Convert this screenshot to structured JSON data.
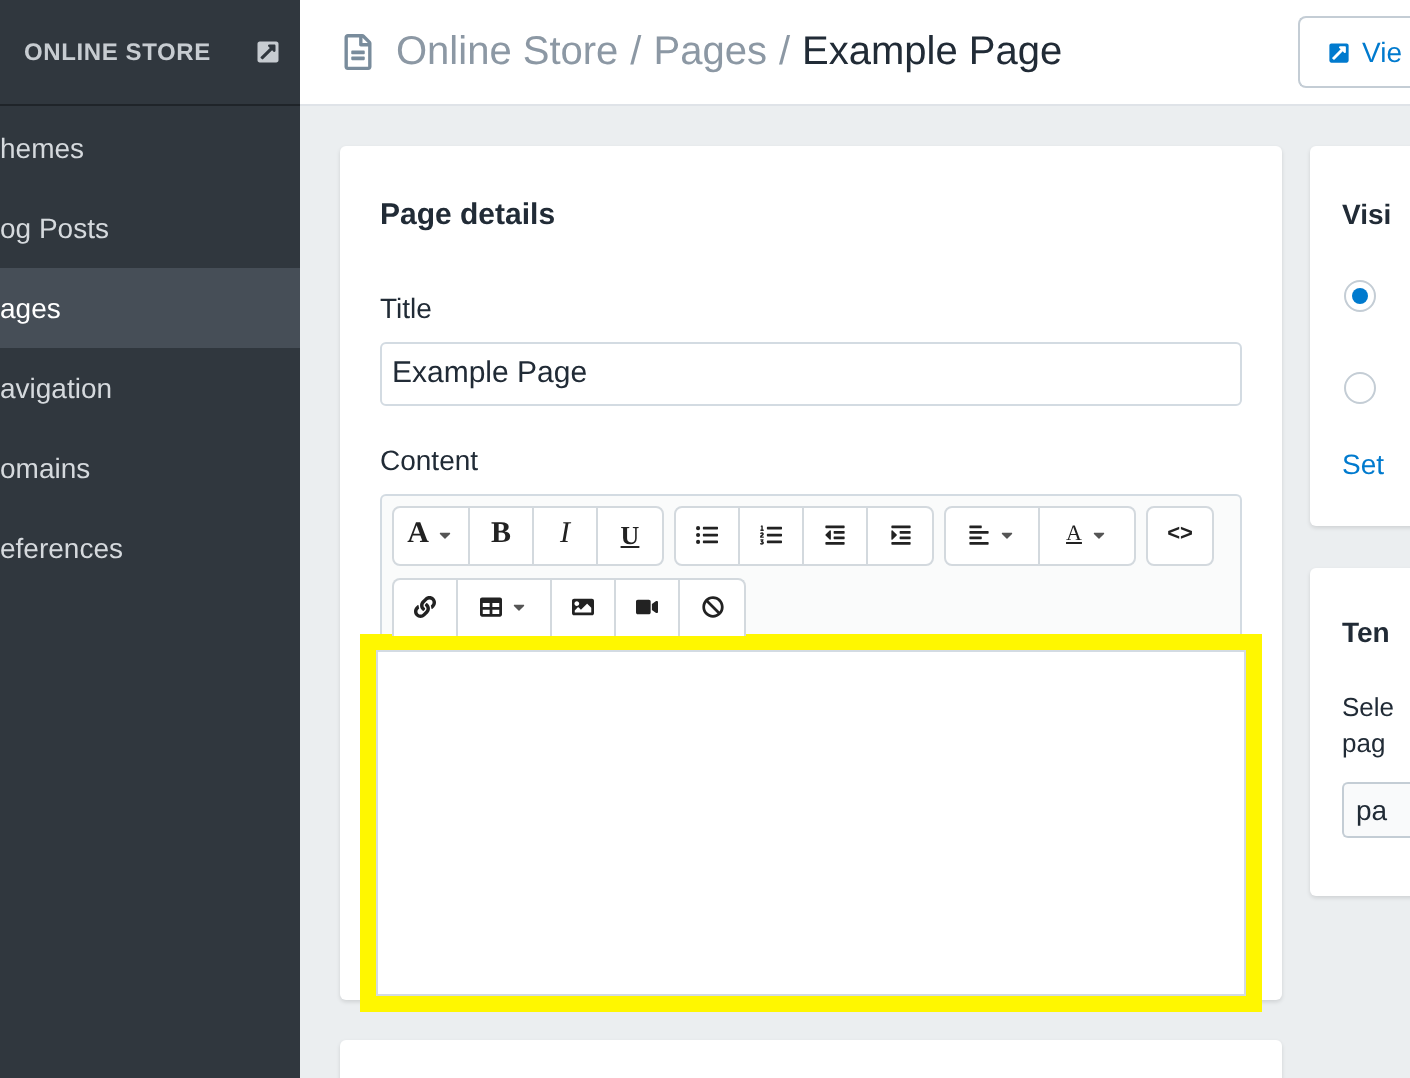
{
  "sidebar": {
    "title": "ONLINE STORE",
    "items": [
      {
        "label": "hemes",
        "selected": false
      },
      {
        "label": "og Posts",
        "selected": false
      },
      {
        "label": "ages",
        "selected": true
      },
      {
        "label": "avigation",
        "selected": false
      },
      {
        "label": "omains",
        "selected": false
      },
      {
        "label": "eferences",
        "selected": false
      }
    ]
  },
  "header": {
    "breadcrumb": [
      {
        "label": "Online Store",
        "separator": "/"
      },
      {
        "label": "Pages",
        "separator": "/"
      }
    ],
    "current": "Example Page",
    "view_button": "Vie"
  },
  "page_details": {
    "title": "Page details",
    "title_label": "Title",
    "title_value": "Example Page",
    "content_label": "Content",
    "toolbar": [
      [
        {
          "kind": "text",
          "label": "A"
        },
        {
          "kind": "text",
          "label": "B"
        },
        {
          "kind": "text",
          "label": "I"
        },
        {
          "kind": "text",
          "label": "U"
        }
      ],
      [
        {
          "kind": "icon"
        },
        {
          "kind": "icon"
        },
        {
          "kind": "icon"
        },
        {
          "kind": "icon"
        }
      ],
      [
        {
          "kind": "icon"
        },
        {
          "kind": "text",
          "label": "A"
        }
      ],
      [
        {
          "kind": "text",
          "label": "<>"
        }
      ],
      [
        {
          "kind": "icon"
        },
        {
          "kind": "icon"
        },
        {
          "kind": "icon"
        },
        {
          "kind": "icon"
        },
        {
          "kind": "icon"
        }
      ]
    ],
    "editor_highlighted": true
  },
  "visibility": {
    "title": "Visi",
    "options": [
      {
        "selected": true
      },
      {
        "selected": false
      }
    ],
    "link": "Set"
  },
  "template": {
    "title": "Ten",
    "description": [
      "Sele",
      "pag"
    ],
    "select_value": "pa"
  }
}
